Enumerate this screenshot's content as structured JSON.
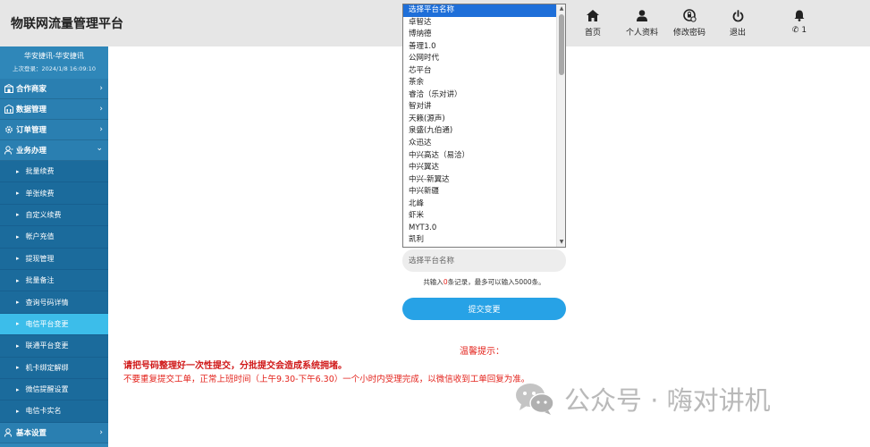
{
  "header": {
    "title": "物联网流量管理平台",
    "nav": [
      {
        "label": "首页",
        "icon": "home-icon"
      },
      {
        "label": "个人资料",
        "icon": "user-icon"
      },
      {
        "label": "修改密码",
        "icon": "password-icon"
      },
      {
        "label": "退出",
        "icon": "power-icon"
      }
    ],
    "bell_icon": "bell-icon",
    "phone_icon": "phone-icon",
    "notification_count": "1"
  },
  "sidebar": {
    "user_name": "华安捷讯-华安捷讯",
    "last_login": "上次登录：2024/1/8 16:09:10",
    "sections": [
      {
        "label": "合作商家",
        "icon": "partner-icon",
        "arrow": "›"
      },
      {
        "label": "数据管理",
        "icon": "data-icon",
        "arrow": "›"
      },
      {
        "label": "订单管理",
        "icon": "gear-icon",
        "arrow": "›"
      },
      {
        "label": "业务办理",
        "icon": "user-business-icon",
        "arrow": "⌄"
      }
    ],
    "items": [
      {
        "label": "批量续费",
        "active": false
      },
      {
        "label": "单张续费",
        "active": false
      },
      {
        "label": "自定义续费",
        "active": false
      },
      {
        "label": "帐户充值",
        "active": false
      },
      {
        "label": "提现管理",
        "active": false
      },
      {
        "label": "批量备注",
        "active": false
      },
      {
        "label": "查询号码详情",
        "active": false
      },
      {
        "label": "电信平台变更",
        "active": true
      },
      {
        "label": "联通平台变更",
        "active": false
      },
      {
        "label": "机卡绑定解绑",
        "active": false
      },
      {
        "label": "微信提醒设置",
        "active": false
      },
      {
        "label": "电信卡实名",
        "active": false
      }
    ],
    "bottom_section": {
      "label": "基本设置",
      "icon": "settings-user-icon",
      "arrow": "›"
    },
    "bullet": "▸"
  },
  "platform_list": {
    "options": [
      "选择平台名称",
      "卓智达",
      "博纳德",
      "善理1.0",
      "公网时代",
      "芯平台",
      "茶余",
      "睿洽（乐对讲）",
      "智对讲",
      "天籁(源声)",
      "泉盛(九伯通)",
      "众迅达",
      "中兴高达（易洽）",
      "中兴翼达",
      "中兴-新翼达",
      "中兴新疆",
      "北峰",
      "虾米",
      "MYT3.0",
      "凯利"
    ],
    "selected_index": 0,
    "scroll_up": "▲",
    "scroll_down": "▼"
  },
  "search": {
    "placeholder": "选择平台名称"
  },
  "count_note": {
    "prefix": "共输入",
    "count": "0",
    "suffix": "条记录，最多可以输入5000条。"
  },
  "submit_label": "提交变更",
  "tips": {
    "title": "温馨提示：",
    "line1": "请把号码整理好一次性提交，分批提交会造成系统拥堵。",
    "line2": "不要重复提交工单，正常上班时间（上午9.30-下午6.30）一个小时内受理完成，以微信收到工单回复为准。"
  },
  "watermark": {
    "text": "公众号 · 嗨对讲机",
    "icon": "wechat-logo-icon"
  }
}
